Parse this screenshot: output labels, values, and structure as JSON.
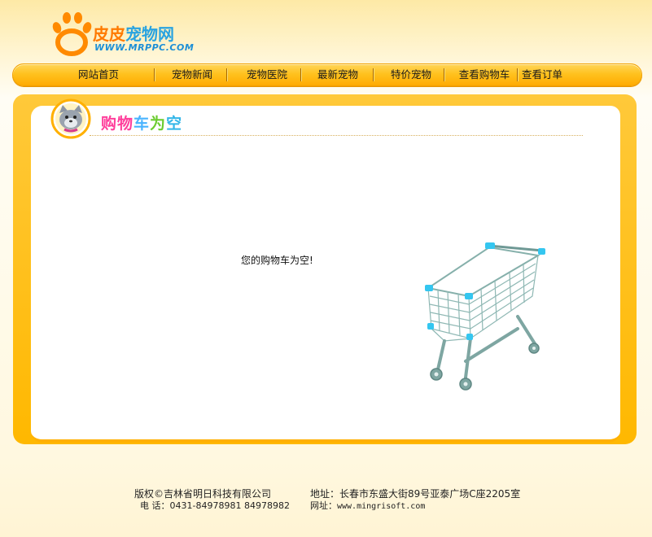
{
  "header": {
    "brand_part1": "皮皮",
    "brand_part2": "宠物网",
    "url": "WWW.MRPPC.COM",
    "logo_icon": "paw-print-icon"
  },
  "nav": {
    "items": [
      {
        "label": "网站首页"
      },
      {
        "label": "宠物新闻"
      },
      {
        "label": "宠物医院"
      },
      {
        "label": "最新宠物"
      },
      {
        "label": "特价宠物"
      },
      {
        "label": "查看购物车"
      },
      {
        "label": "查看订单"
      }
    ]
  },
  "section": {
    "title": [
      "购",
      "物",
      "车",
      "为",
      "空"
    ],
    "badge_icon": "cat-avatar-icon"
  },
  "main": {
    "empty_message": "您的购物车为空!",
    "illustration": "shopping-cart-icon"
  },
  "footer": {
    "copyright": "版权©吉林省明日科技有限公司",
    "phone_label": "电  话：",
    "phone_value": "0431-84978981 84978982",
    "address": "地址：长春市东盛大街89号亚泰广场C座2205室",
    "website_label": "网址：",
    "website_value": "www.mingrisoft.com"
  },
  "colors": {
    "nav_gradient_top": "#ffd55a",
    "nav_gradient_bottom": "#ffab00",
    "panel_border": "#ffb800",
    "accent_cyan": "#29c0ee"
  }
}
